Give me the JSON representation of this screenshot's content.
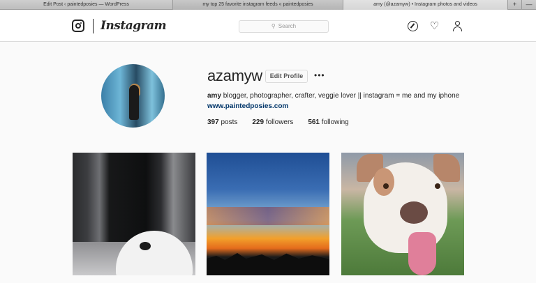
{
  "browser": {
    "tabs": [
      {
        "title": "Edit Post ‹ paintedposies — WordPress"
      },
      {
        "title": "my top 25 favorite instagram feeds « paintedposies"
      },
      {
        "title": "amy (@azamyw) • Instagram photos and videos"
      }
    ],
    "new_tab_label": "+",
    "tab_menu_label": "—"
  },
  "nav": {
    "logo_text": "Instagram",
    "search_placeholder": "Search",
    "icons": [
      "instagram-camera-icon",
      "compass-icon",
      "heart-icon",
      "person-icon"
    ]
  },
  "profile": {
    "username": "azamyw",
    "edit_button": "Edit Profile",
    "more_label": "•••",
    "name": "amy",
    "bio": " blogger, photographer, crafter, veggie lover || instagram = me and my iphone",
    "website": "www.paintedposies.com",
    "stats": [
      {
        "count": "397",
        "label": "posts"
      },
      {
        "count": "229",
        "label": "followers"
      },
      {
        "count": "561",
        "label": "following"
      }
    ]
  },
  "grid": {
    "photos": [
      "dog-in-hallway-photo",
      "sunset-sky-photo",
      "dog-portrait-photo"
    ]
  },
  "colors": {
    "link": "#003569",
    "border": "#dbdbdb",
    "background": "#fafafa"
  }
}
